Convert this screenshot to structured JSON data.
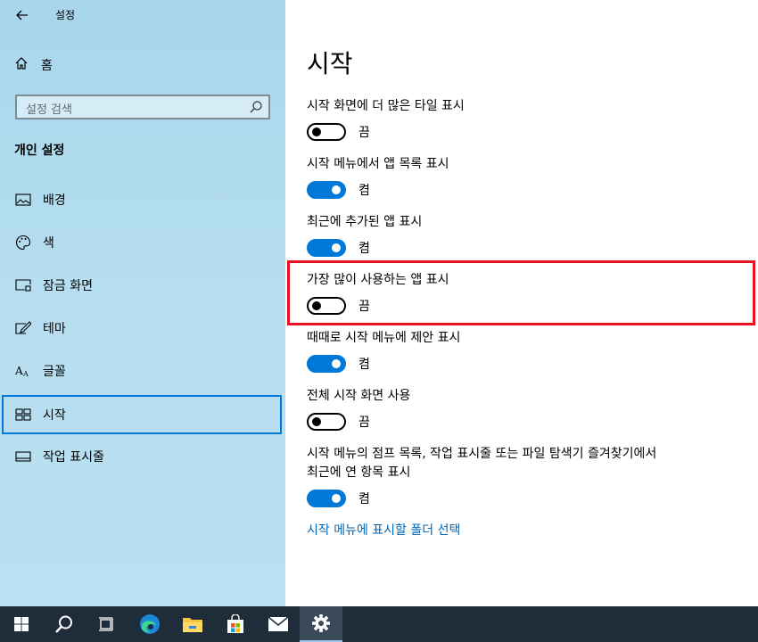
{
  "window": {
    "title": "설정"
  },
  "sidebar": {
    "home_label": "홈",
    "search_placeholder": "설정 검색",
    "section_title": "개인 설정",
    "items": [
      {
        "label": "배경",
        "icon": "picture-icon"
      },
      {
        "label": "색",
        "icon": "palette-icon"
      },
      {
        "label": "잠금 화면",
        "icon": "lock-screen-icon"
      },
      {
        "label": "테마",
        "icon": "theme-icon"
      },
      {
        "label": "글꼴",
        "icon": "font-icon"
      },
      {
        "label": "시작",
        "icon": "start-icon",
        "selected": true
      },
      {
        "label": "작업 표시줄",
        "icon": "taskbar-icon"
      }
    ]
  },
  "main": {
    "title": "시작",
    "settings": [
      {
        "label": "시작 화면에 더 많은 타일 표시",
        "on": false,
        "state": "끔"
      },
      {
        "label": "시작 메뉴에서 앱 목록 표시",
        "on": true,
        "state": "켬"
      },
      {
        "label": "최근에 추가된 앱 표시",
        "on": true,
        "state": "켬"
      },
      {
        "label": "가장 많이 사용하는 앱 표시",
        "on": false,
        "state": "끔",
        "highlighted": true
      },
      {
        "label": "때때로 시작 메뉴에 제안 표시",
        "on": true,
        "state": "켬"
      },
      {
        "label": "전체 시작 화면 사용",
        "on": false,
        "state": "끔"
      },
      {
        "label_line1": "시작 메뉴의 점프 목록, 작업 표시줄 또는 파일 탐색기 즐겨찾기에서",
        "label_line2": "최근에 연 항목 표시",
        "on": true,
        "state": "켬"
      }
    ],
    "link": "시작 메뉴에 표시할 폴더 선택"
  },
  "colors": {
    "accent": "#0078d7",
    "highlight": "#e81123",
    "link": "#0067b8",
    "taskbar": "#1f2d3a"
  },
  "taskbar": {
    "icons": [
      "windows-start-icon",
      "search-icon",
      "task-view-icon",
      "edge-icon",
      "file-explorer-icon",
      "store-icon",
      "mail-icon",
      "settings-icon"
    ],
    "active": "settings-icon"
  }
}
